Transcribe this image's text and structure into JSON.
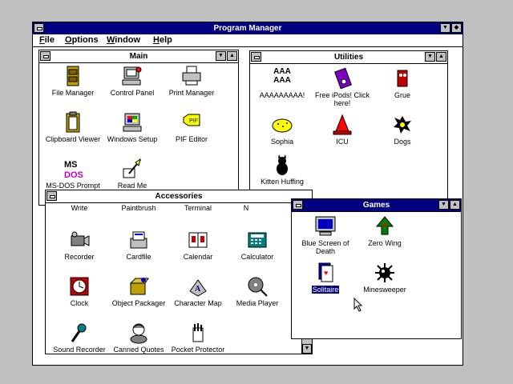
{
  "program_manager": {
    "title": "Program Manager",
    "menu": [
      "File",
      "Options",
      "Window",
      "Help"
    ]
  },
  "main": {
    "title": "Main",
    "icons": [
      "File Manager",
      "Control Panel",
      "Print Manager",
      "Clipboard Viewer",
      "Windows Setup",
      "PIF Editor",
      "MS-DOS Prompt",
      "Read Me"
    ]
  },
  "utilities": {
    "title": "Utilities",
    "icons": [
      "AAAAAAAAA!",
      "Free iPods! Click here!",
      "Grue",
      "Sophia",
      "ICU",
      "Dogs",
      "Kitten Huffing"
    ],
    "aaa_glyph": "AAA\nAAA"
  },
  "accessories": {
    "title": "Accessories",
    "partial_row": [
      "Write",
      "Paintbrush",
      "Terminal",
      "N"
    ],
    "icons": [
      "Recorder",
      "Cardfile",
      "Calendar",
      "Calculator",
      "Clock",
      "Object Packager",
      "Character Map",
      "Media Player",
      "Sound Recorder",
      "Canned Quotes",
      "Pocket Protector"
    ]
  },
  "games": {
    "title": "Games",
    "icons": [
      "Blue Screen of Death",
      "Zero Wing",
      "Solitaire",
      "Minesweeper"
    ],
    "selected": "Solitaire"
  },
  "icon_names": {
    "restore": "restore-icon",
    "minimize": "minimize-icon",
    "maximize": "maximize-icon"
  },
  "colors": {
    "desktop": "#c0c0c0",
    "active_title": "#000080",
    "selection": "#000080"
  }
}
